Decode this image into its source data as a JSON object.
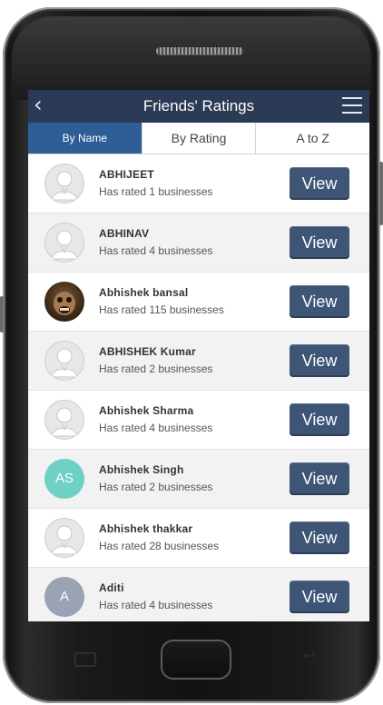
{
  "header": {
    "title": "Friends' Ratings",
    "back_glyph": "‹",
    "menu_icon": "hamburger-menu-icon"
  },
  "tabs": [
    {
      "label": "By Name",
      "active": true
    },
    {
      "label": "By Rating",
      "active": false
    },
    {
      "label": "A to Z",
      "active": false
    }
  ],
  "friends": [
    {
      "name": "ABHIJEET",
      "subtitle": "Has rated 1 businesses",
      "avatar": "default",
      "button": "View"
    },
    {
      "name": "ABHINAV",
      "subtitle": "Has rated 4 businesses",
      "avatar": "default",
      "button": "View"
    },
    {
      "name": "Abhishek bansal",
      "subtitle": "Has rated 115 businesses",
      "avatar": "photo",
      "button": "View"
    },
    {
      "name": "ABHISHEK Kumar",
      "subtitle": "Has rated 2 businesses",
      "avatar": "default",
      "button": "View"
    },
    {
      "name": "Abhishek Sharma",
      "subtitle": "Has rated 4 businesses",
      "avatar": "default",
      "button": "View"
    },
    {
      "name": "Abhishek Singh",
      "subtitle": "Has rated 2 businesses",
      "avatar": "initials",
      "initials": "AS",
      "button": "View"
    },
    {
      "name": "Abhishek thakkar",
      "subtitle": "Has rated 28 businesses",
      "avatar": "default",
      "button": "View"
    },
    {
      "name": "Aditi",
      "subtitle": "Has rated 4 businesses",
      "avatar": "initials",
      "initials": "A",
      "button": "View"
    }
  ],
  "colors": {
    "appbar": "#2b3a55",
    "tab_active": "#2e5e95",
    "button": "#3e5576",
    "avatar_teal": "#6fd0c5",
    "avatar_gray": "#9aa3b4"
  }
}
